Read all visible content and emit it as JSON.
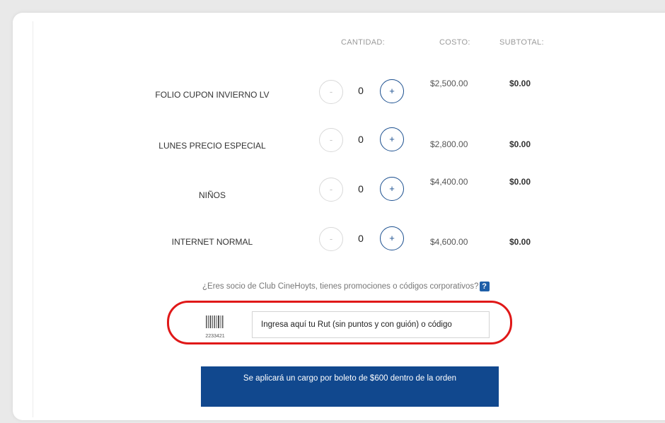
{
  "headers": {
    "cantidad": "CANTIDAD:",
    "costo": "COSTO:",
    "subtotal": "SUBTOTAL:"
  },
  "tickets": [
    {
      "label": "FOLIO CUPON INVIERNO LV",
      "qty": "0",
      "price": "$2,500.00",
      "subtotal": "$0.00",
      "minus": "-",
      "plus": "+"
    },
    {
      "label": "LUNES PRECIO ESPECIAL",
      "qty": "0",
      "price": "$2,800.00",
      "subtotal": "$0.00",
      "minus": "-",
      "plus": "+"
    },
    {
      "label": "NIÑOS",
      "qty": "0",
      "price": "$4,400.00",
      "subtotal": "$0.00",
      "minus": "-",
      "plus": "+"
    },
    {
      "label": "INTERNET NORMAL",
      "qty": "0",
      "price": "$4,600.00",
      "subtotal": "$0.00",
      "minus": "-",
      "plus": "+"
    }
  ],
  "promo": {
    "question": "¿Eres socio de Club CineHoyts, tienes promociones o códigos corporativos?",
    "help_label": "?",
    "barcode_number": "2233421",
    "input_value": "Ingresa aquí tu Rut (sin puntos y con guión) o código"
  },
  "notice": "Se aplicará un cargo por boleto de $600 dentro de la orden",
  "colors": {
    "accent": "#1b4f8f",
    "notice_bg": "#11488e",
    "highlight": "#e01818"
  }
}
